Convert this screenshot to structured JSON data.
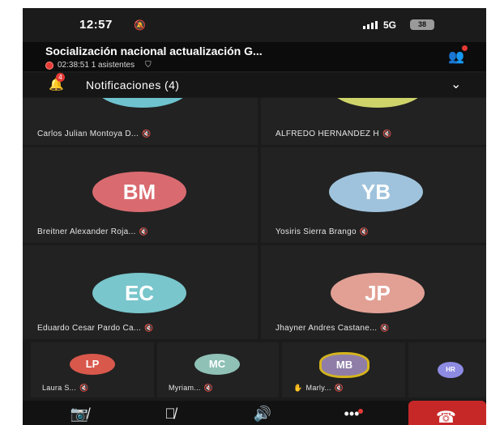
{
  "status_bar": {
    "time": "12:57",
    "network": "5G",
    "battery": "38"
  },
  "meeting": {
    "title": "Socialización nacional actualización G...",
    "recording": "02:38:51 1 asistentes"
  },
  "notifications": {
    "label": "Notificaciones (4)",
    "badge": "4"
  },
  "participants": [
    {
      "name": "Carlos Julian Montoya D...",
      "initials": "",
      "color": "#6ec3cf"
    },
    {
      "name": "ALFREDO HERNANDEZ H",
      "initials": "",
      "color": "#cfd46a"
    },
    {
      "name": "Breitner Alexander Roja...",
      "initials": "BM",
      "color": "#d96b70"
    },
    {
      "name": "Yosiris Sierra Brango",
      "initials": "YB",
      "color": "#9fc3dc"
    },
    {
      "name": "Eduardo Cesar Pardo Ca...",
      "initials": "EC",
      "color": "#79c6cc"
    },
    {
      "name": "Jhayner Andres Castane...",
      "initials": "JP",
      "color": "#e2a095"
    }
  ],
  "small_participants": [
    {
      "name": "Laura S...",
      "initials": "LP",
      "color": "#d9584c"
    },
    {
      "name": "Myriam...",
      "initials": "MC",
      "color": "#8fc1b7"
    },
    {
      "name": "Marly...",
      "initials": "MB",
      "color": "#8f7da8",
      "ring": "#d4b41e"
    },
    {
      "name": "",
      "initials": "HR",
      "color": "#8e8be3"
    }
  ],
  "colors": {
    "background": "#1b1b1b",
    "tile": "#222222",
    "hangup": "#c62828",
    "accent_red": "#e53935"
  },
  "icons": {
    "camera_off": "camera-off-icon",
    "mic_off": "mic-off-icon",
    "speaker": "speaker-icon",
    "more": "more-icon",
    "hangup": "phone-hangup-icon"
  }
}
